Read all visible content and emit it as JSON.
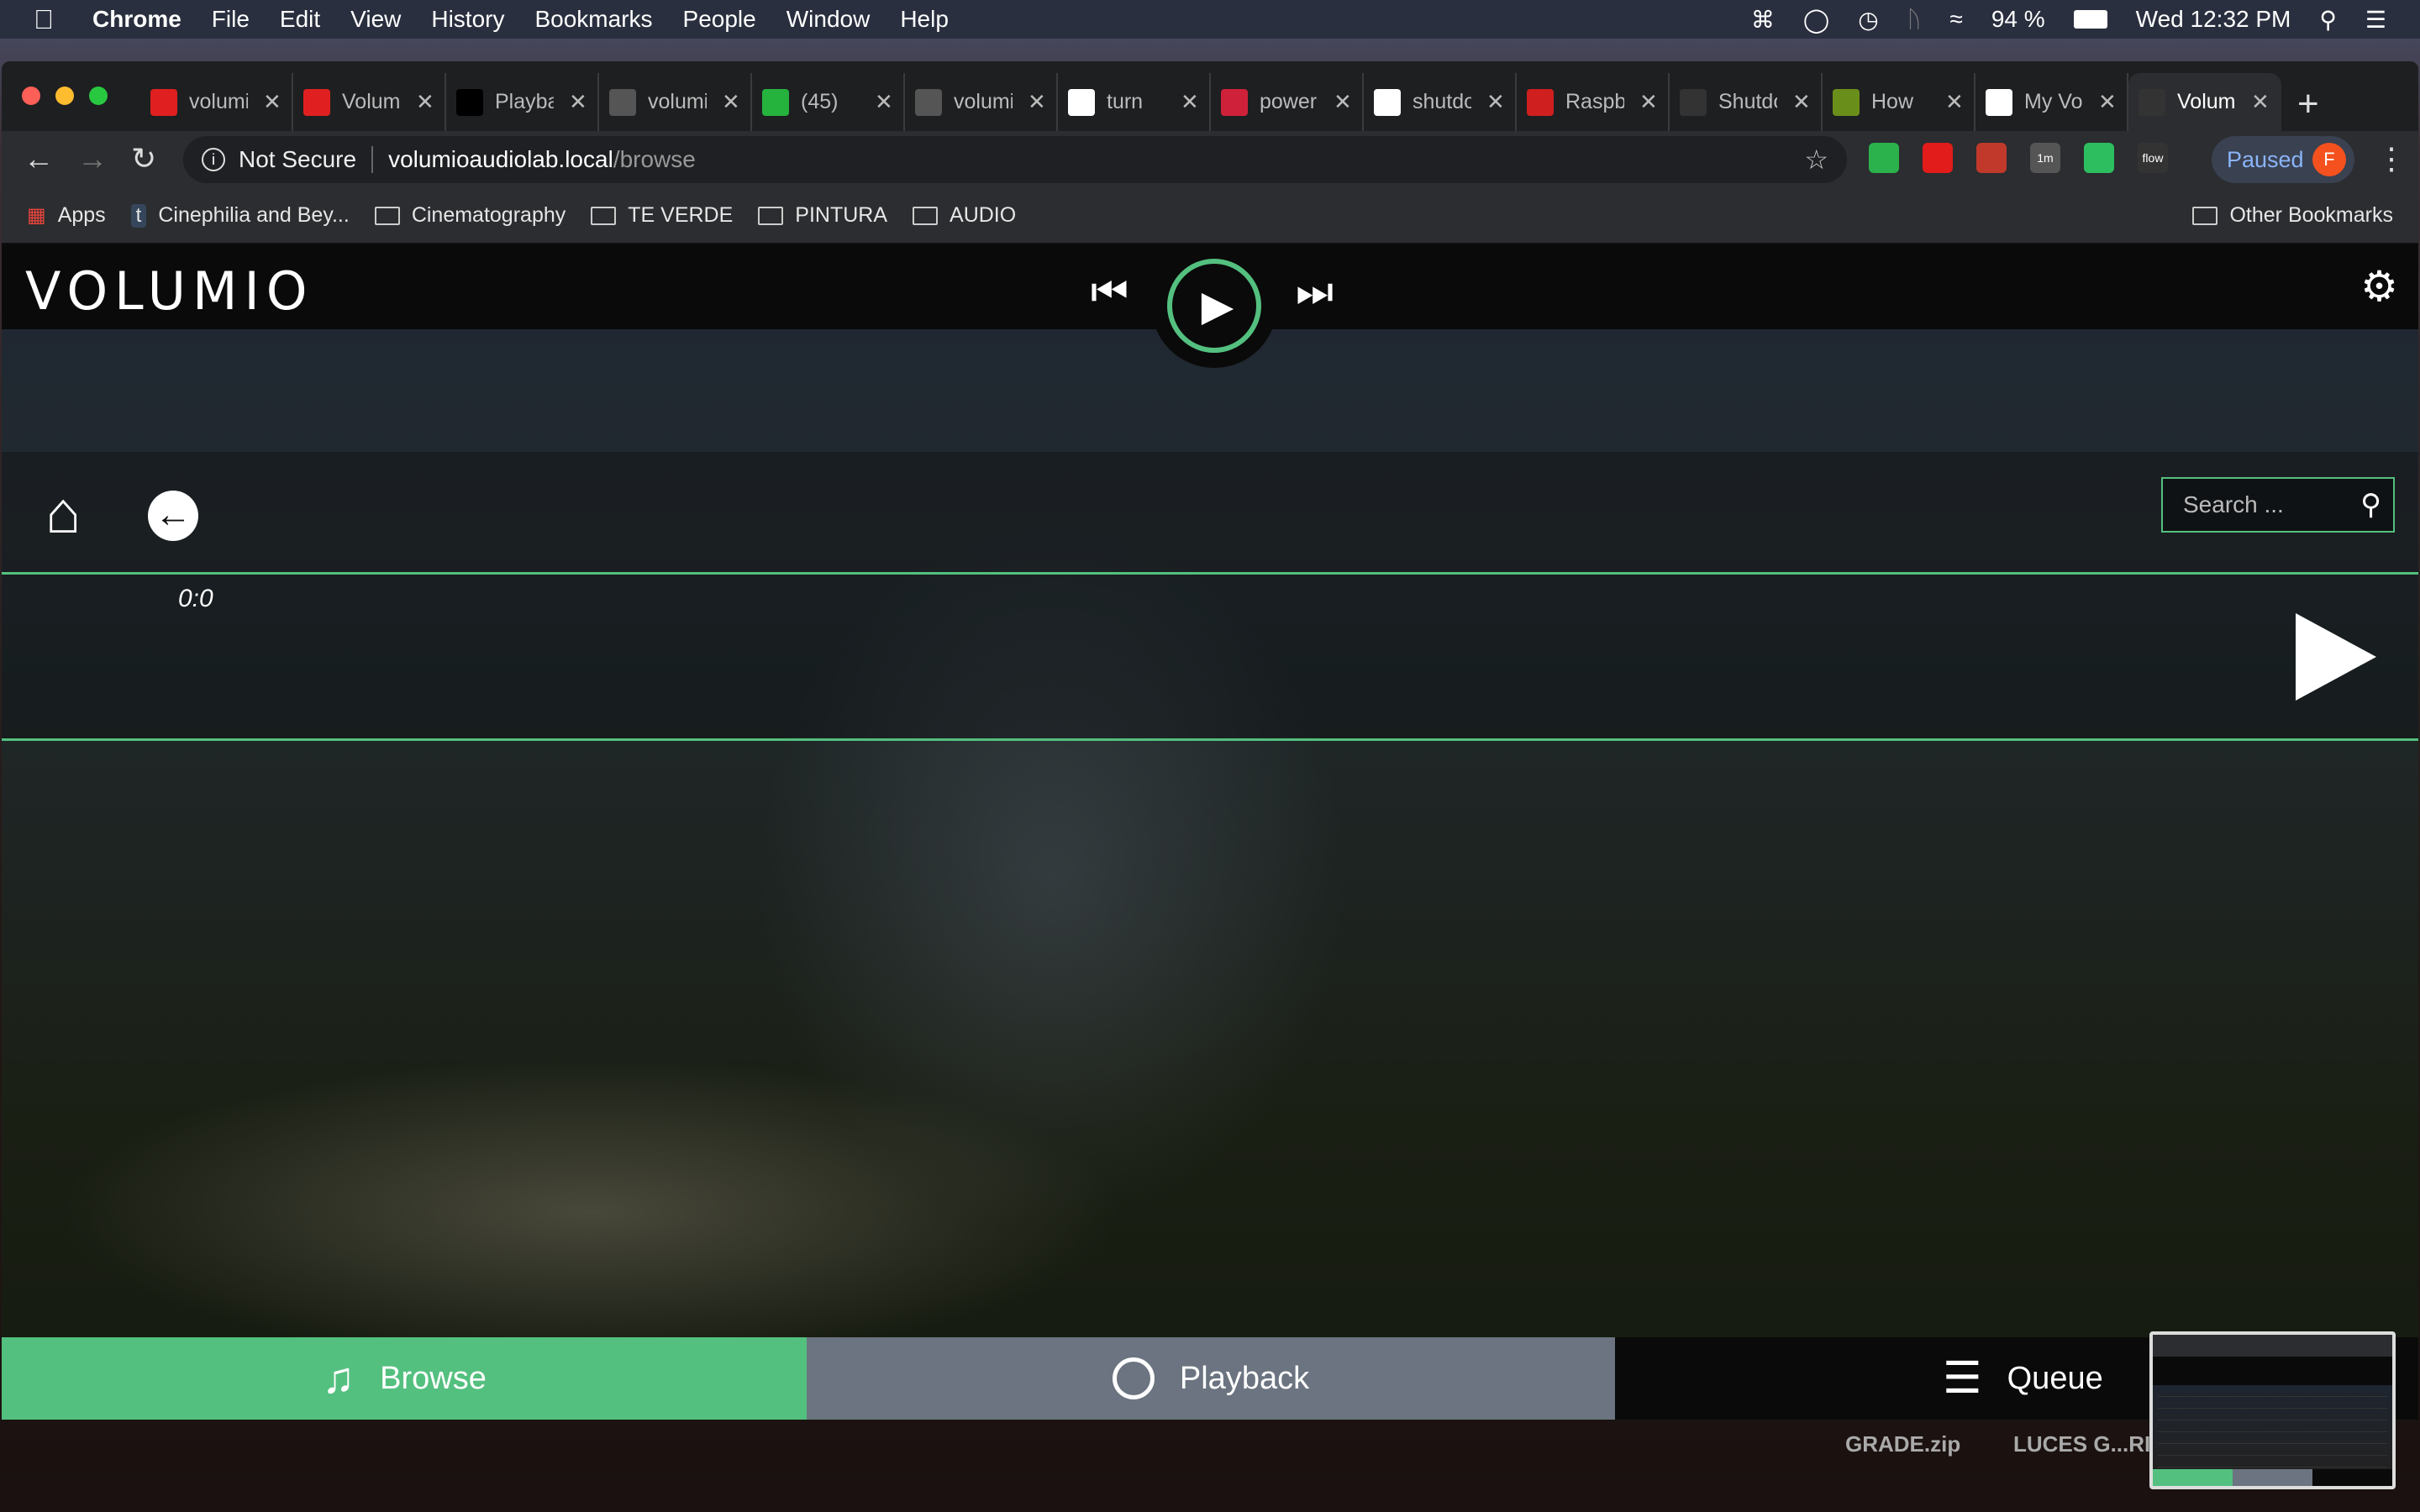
{
  "menubar": {
    "app": "Chrome",
    "items": [
      "File",
      "Edit",
      "View",
      "History",
      "Bookmarks",
      "People",
      "Window",
      "Help"
    ],
    "battery": "94 %",
    "clock": "Wed 12:32 PM"
  },
  "tabs": [
    {
      "title": "volumio",
      "icon": "avatar-red",
      "color": "#e02020"
    },
    {
      "title": "Volumio",
      "icon": "avatar-red",
      "color": "#e02020"
    },
    {
      "title": "Playback",
      "icon": "search-q-icon",
      "color": "#000000"
    },
    {
      "title": "volumio",
      "icon": "globe-icon",
      "color": "#555555"
    },
    {
      "title": "(45)",
      "icon": "whatsapp-icon",
      "color": "#25b33e"
    },
    {
      "title": "volumio",
      "icon": "globe-icon",
      "color": "#555555"
    },
    {
      "title": "turn",
      "icon": "google-icon",
      "color": "#ffffff"
    },
    {
      "title": "power",
      "icon": "raspberry-icon",
      "color": "#d0213a"
    },
    {
      "title": "shutdown",
      "icon": "google-icon",
      "color": "#ffffff"
    },
    {
      "title": "Raspberry",
      "icon": "raspi-icon",
      "color": "#d01f1f"
    },
    {
      "title": "Shutdown",
      "icon": "volumio-icon",
      "color": "#333333"
    },
    {
      "title": "How",
      "icon": "h-icon",
      "color": "#6a8e1a"
    },
    {
      "title": "My Volumio",
      "icon": "volumio-icon",
      "color": "#ffffff"
    },
    {
      "title": "Volumio",
      "icon": "volumio-icon",
      "color": "#333333",
      "active": true
    }
  ],
  "address": {
    "security": "Not Secure",
    "host": "volumioaudiolab.local",
    "path": "/browse"
  },
  "profile": {
    "label": "Paused",
    "initial": "F"
  },
  "extensions": [
    {
      "name": "feedly",
      "label": "",
      "color": "#2bb24c"
    },
    {
      "name": "adblock",
      "label": "",
      "color": "#e21b1b"
    },
    {
      "name": "reader",
      "label": "",
      "color": "#c0392b"
    },
    {
      "name": "timer",
      "label": "1m",
      "color": "#555555"
    },
    {
      "name": "evernote",
      "label": "",
      "color": "#2dbe60"
    },
    {
      "name": "flow",
      "label": "flow",
      "color": "#333333"
    }
  ],
  "bookmarks": {
    "apps": "Apps",
    "items": [
      "Cinephilia and Bey...",
      "Cinematography",
      "TE VERDE",
      "PINTURA",
      "AUDIO"
    ],
    "other": "Other Bookmarks"
  },
  "volumio": {
    "logo": "VOLUMIO",
    "accent": "#54c07f",
    "search_placeholder": "Search ...",
    "time": "0:0",
    "nav": {
      "browse": "Browse",
      "playback": "Playback",
      "queue": "Queue"
    }
  },
  "desktop": {
    "files": [
      "GRADE.zip",
      "LUCES G...RIE"
    ]
  }
}
